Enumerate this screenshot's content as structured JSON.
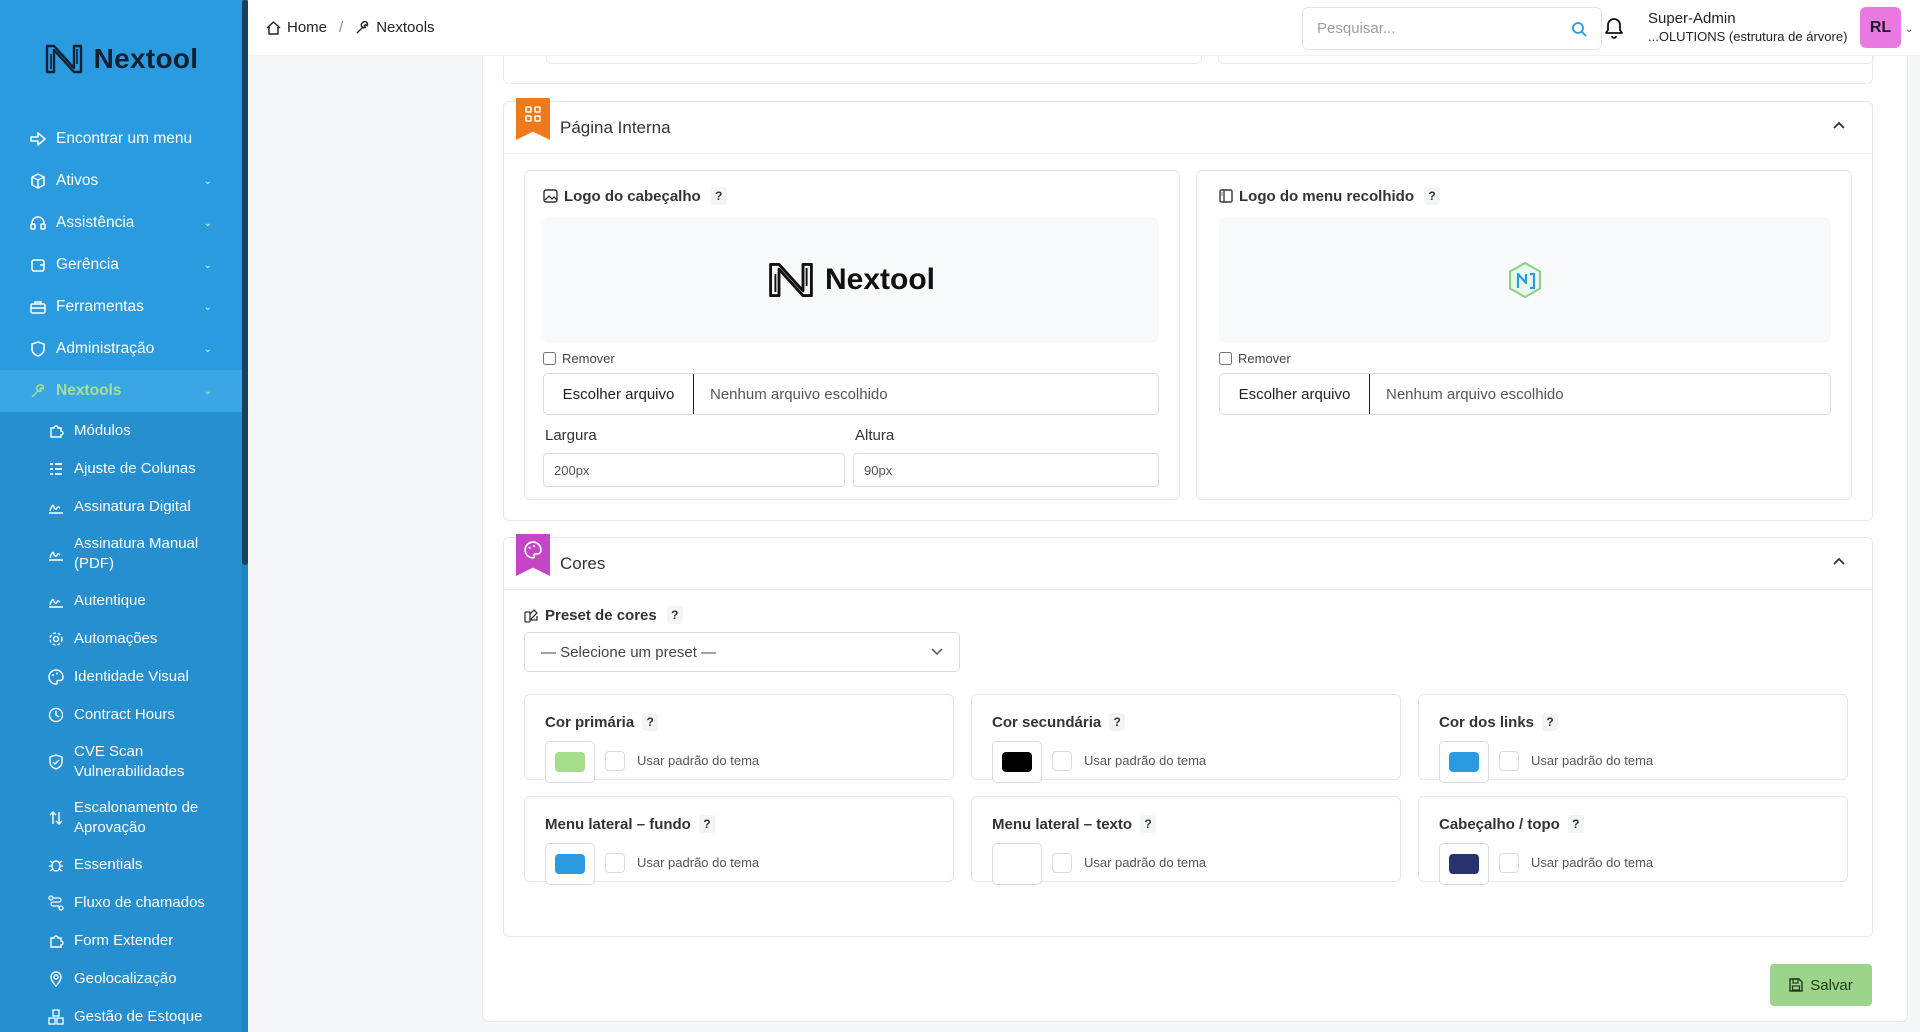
{
  "brand": {
    "name": "Nextool"
  },
  "sidebar": {
    "items": [
      {
        "label": "Encontrar um menu",
        "icon": "arrow-right-icon",
        "chevron": false
      },
      {
        "label": "Ativos",
        "icon": "cube-icon",
        "chevron": true
      },
      {
        "label": "Assistência",
        "icon": "headset-icon",
        "chevron": true
      },
      {
        "label": "Gerência",
        "icon": "wallet-icon",
        "chevron": true
      },
      {
        "label": "Ferramentas",
        "icon": "toolbox-icon",
        "chevron": true
      },
      {
        "label": "Administração",
        "icon": "shield-icon",
        "chevron": true
      },
      {
        "label": "Nextools",
        "icon": "tools-icon",
        "chevron": true,
        "active": true
      }
    ],
    "subitems": [
      {
        "label": "Módulos",
        "icon": "puzzle-icon"
      },
      {
        "label": "Ajuste de Colunas",
        "icon": "columns-icon"
      },
      {
        "label": "Assinatura Digital",
        "icon": "signature-icon"
      },
      {
        "label": "Assinatura Manual (PDF)",
        "icon": "signature-icon"
      },
      {
        "label": "Autentique",
        "icon": "signature-icon"
      },
      {
        "label": "Automações",
        "icon": "gear-icon"
      },
      {
        "label": "Identidade Visual",
        "icon": "palette-icon"
      },
      {
        "label": "Contract Hours",
        "icon": "clock-icon"
      },
      {
        "label": "CVE Scan Vulnerabilidades",
        "icon": "shield-check-icon"
      },
      {
        "label": "Escalonamento de Aprovação",
        "icon": "arrows-updown-icon"
      },
      {
        "label": "Essentials",
        "icon": "bug-icon"
      },
      {
        "label": "Fluxo de chamados",
        "icon": "flow-icon"
      },
      {
        "label": "Form Extender",
        "icon": "puzzle-icon"
      },
      {
        "label": "Geolocalização",
        "icon": "location-icon"
      },
      {
        "label": "Gestão de Estoque",
        "icon": "boxes-icon"
      }
    ]
  },
  "header": {
    "breadcrumb": [
      {
        "label": "Home"
      },
      {
        "label": "Nextools"
      }
    ],
    "separator": "/",
    "search_placeholder": "Pesquisar...",
    "user_name": "Super-Admin",
    "user_org": "...OLUTIONS (estrutura de árvore)",
    "avatar_initials": "RL"
  },
  "internal_page": {
    "title": "Página Interna",
    "header_logo": {
      "title": "Logo do cabeçalho",
      "help": "?",
      "logo_text": "Nextool",
      "remove_label": "Remover",
      "choose_file": "Escolher arquivo",
      "no_file": "Nenhum arquivo escolhido",
      "width_label": "Largura",
      "width_value": "200px",
      "height_label": "Altura",
      "height_value": "90px"
    },
    "collapsed_logo": {
      "title": "Logo do menu recolhido",
      "help": "?",
      "remove_label": "Remover",
      "choose_file": "Escolher arquivo",
      "no_file": "Nenhum arquivo escolhido"
    }
  },
  "colors": {
    "title": "Cores",
    "preset_label": "Preset de cores",
    "preset_help": "?",
    "preset_value": "— Selecione um preset —",
    "theme_default_label": "Usar padrão do tema",
    "cards": [
      {
        "title": "Cor primária",
        "help": "?",
        "color": "#a6dd8c"
      },
      {
        "title": "Cor secundária",
        "help": "?",
        "color": "#000000"
      },
      {
        "title": "Cor dos links",
        "help": "?",
        "color": "#2b9be0"
      },
      {
        "title": "Menu lateral – fundo",
        "help": "?",
        "color": "#2b9be0"
      },
      {
        "title": "Menu lateral – texto",
        "help": "?",
        "color": "#ffffff"
      },
      {
        "title": "Cabeçalho / topo",
        "help": "?",
        "color": "#27336e"
      }
    ]
  },
  "actions": {
    "save_label": "Salvar"
  },
  "theme": {
    "sidebar_bg": "#2b9be0",
    "active_text": "#a7e08f",
    "internal_page_ribbon": "#f07a1a",
    "colors_ribbon": "#c644c6",
    "save_bg": "#9bd48a",
    "avatar_bg": "#e879e0"
  }
}
